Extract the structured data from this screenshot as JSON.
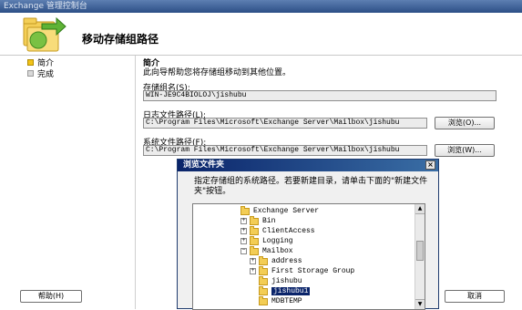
{
  "window": {
    "title": "Exchange 管理控制台"
  },
  "wizard": {
    "title": "移动存储组路径",
    "steps": [
      {
        "label": "简介"
      },
      {
        "label": "完成"
      }
    ]
  },
  "content": {
    "section_title": "简介",
    "description": "此向导帮助您将存储组移动到其他位置。",
    "storage_group_label": "存储组名(S):",
    "storage_group_value": "WIN-JE9C4BIOLOJ\\jishubu",
    "log_path_label": "日志文件路径(L):",
    "log_path_value": "C:\\Program Files\\Microsoft\\Exchange Server\\Mailbox\\jishubu",
    "browse_log_label": "浏览(O)...",
    "system_path_label": "系统文件路径(F):",
    "system_path_value": "C:\\Program Files\\Microsoft\\Exchange Server\\Mailbox\\jishubu",
    "browse_sys_label": "浏览(W)..."
  },
  "footer": {
    "help_label": "帮助(H)",
    "cancel_label": "取消"
  },
  "browse_dialog": {
    "title": "浏览文件夹",
    "close_glyph": "×",
    "description": "指定存储组的系统路径。若要新建目录，请单击下面的\"新建文件夹\"按钮。",
    "tree": [
      {
        "label": "Exchange Server",
        "expander": "−"
      },
      {
        "label": "Bin",
        "expander": "+"
      },
      {
        "label": "ClientAccess",
        "expander": "+"
      },
      {
        "label": "Logging",
        "expander": "+"
      },
      {
        "label": "Mailbox",
        "expander": "−"
      },
      {
        "label": "address",
        "expander": "+"
      },
      {
        "label": "First Storage Group",
        "expander": "+"
      },
      {
        "label": "jishubu",
        "expander": ""
      },
      {
        "label": "jishubu1",
        "expander": "",
        "selected": true
      },
      {
        "label": "MDBTEMP",
        "expander": ""
      }
    ]
  }
}
